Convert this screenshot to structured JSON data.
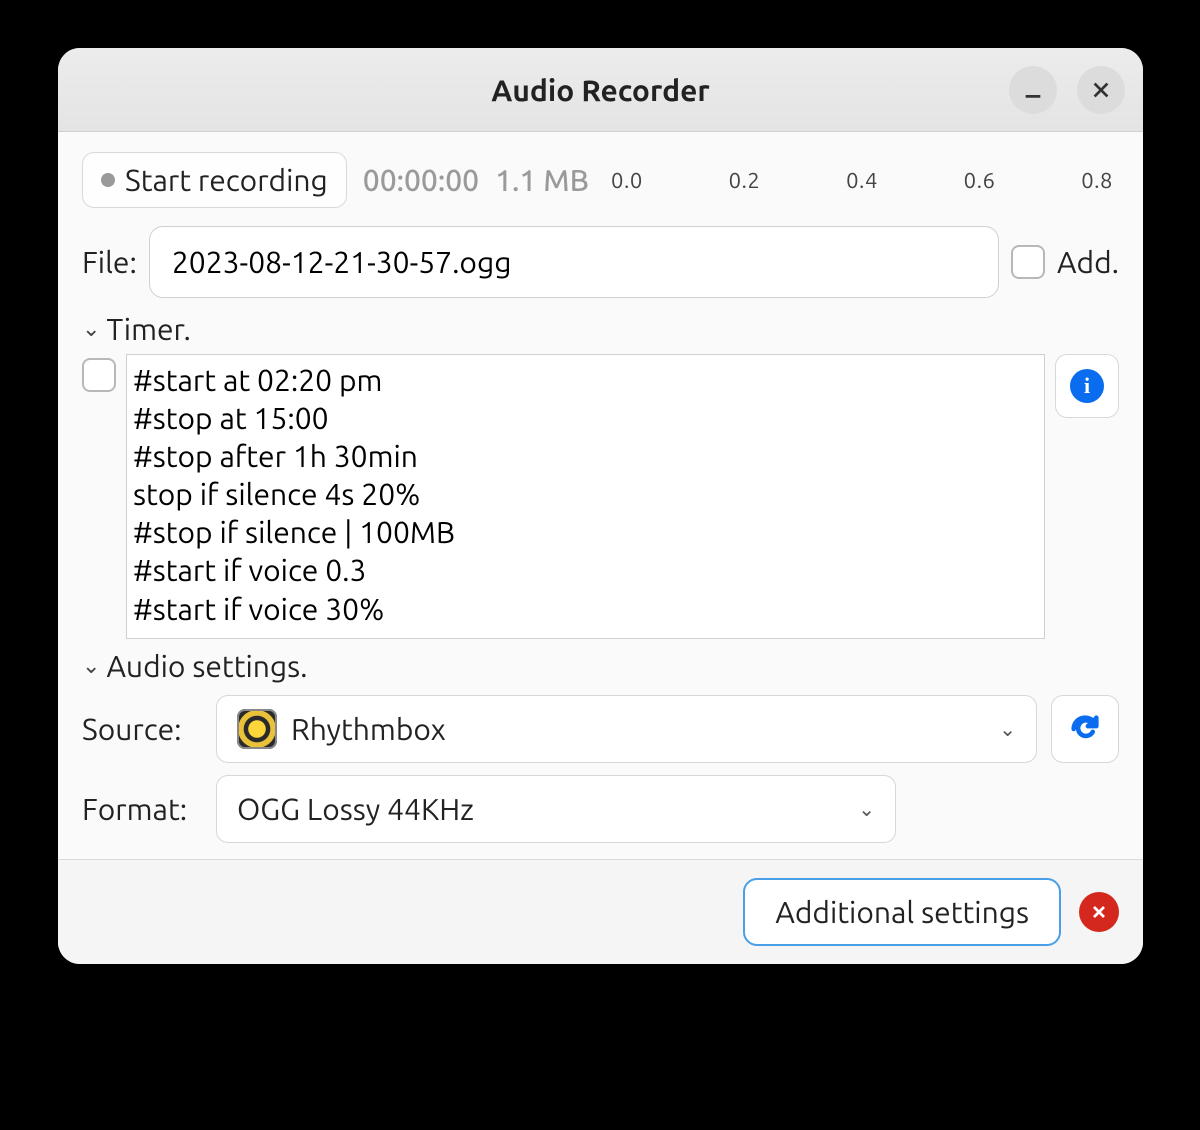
{
  "window": {
    "title": "Audio Recorder"
  },
  "recording": {
    "button_label": "Start recording",
    "time": "00:00:00",
    "size": "1.1 MB",
    "ticks": [
      "0.0",
      "0.2",
      "0.4",
      "0.6",
      "0.8"
    ]
  },
  "file": {
    "label": "File:",
    "value": "2023-08-12-21-30-57.ogg",
    "add_label": "Add."
  },
  "timer": {
    "header": "Timer.",
    "text": "#start at 02:20 pm\n#stop at 15:00\n#stop after 1h 30min\nstop if silence 4s 20%\n#stop if silence | 100MB\n#start if voice 0.3\n#start if voice 30%"
  },
  "audio": {
    "header": "Audio settings.",
    "source_label": "Source:",
    "source_value": "Rhythmbox",
    "format_label": "Format:",
    "format_value": "OGG Lossy 44KHz"
  },
  "bottom": {
    "additional_label": "Additional settings"
  }
}
